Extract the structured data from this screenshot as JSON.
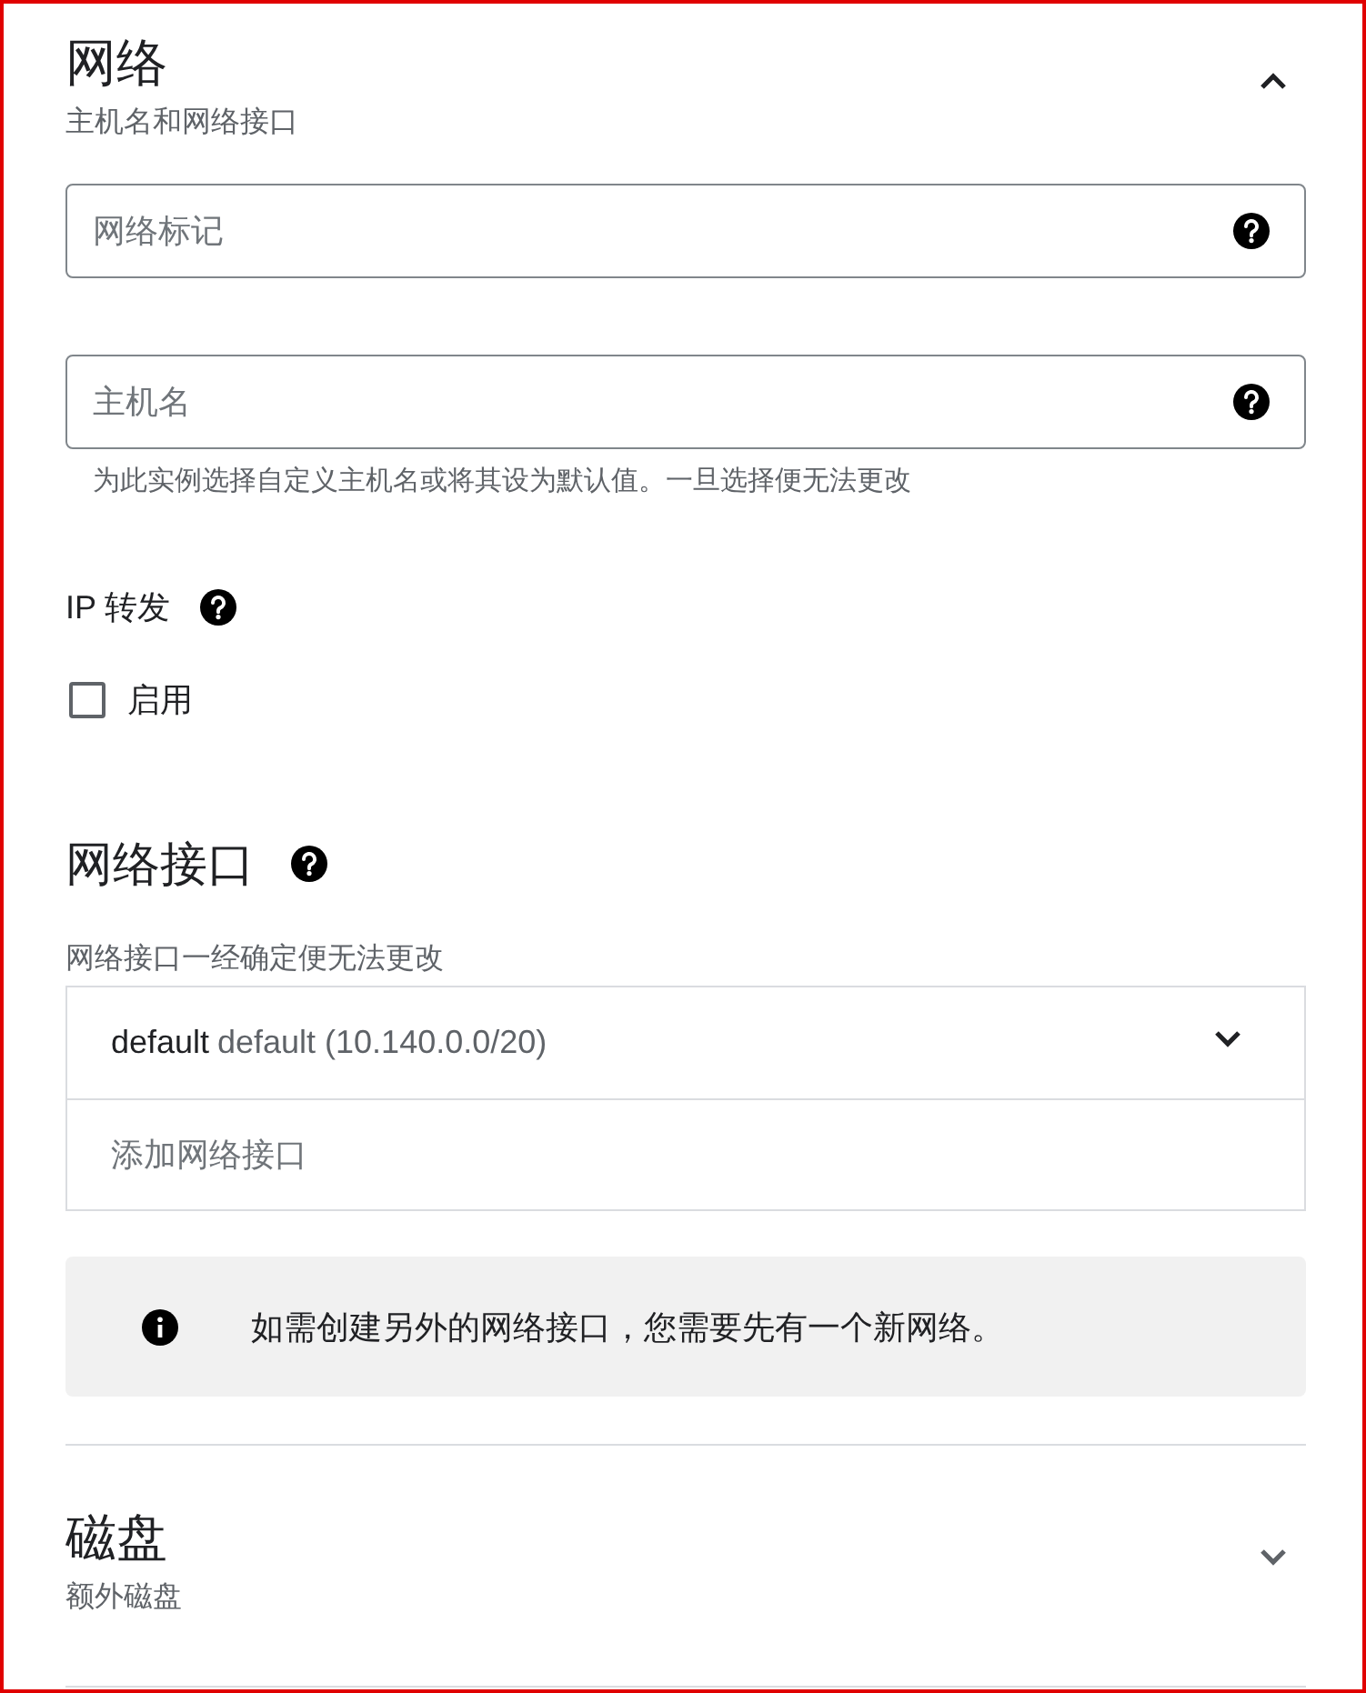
{
  "section": {
    "title": "网络",
    "subtitle": "主机名和网络接口",
    "expanded": true
  },
  "fields": [
    {
      "placeholder": "网络标记"
    },
    {
      "placeholder": "主机名",
      "hint": "为此实例选择自定义主机名或将其设为默认值。一旦选择便无法更改"
    }
  ],
  "ip_forwarding": {
    "label": "IP 转发",
    "checkbox": {
      "label": "启用",
      "checked": false
    }
  },
  "network_interfaces": {
    "title": "网络接口",
    "subtitle": "网络接口一经确定便无法更改",
    "items": [
      {
        "kind": "interface",
        "name": "default",
        "detail": "default (10.140.0.0/20)",
        "expanded": false
      },
      {
        "kind": "add",
        "label": "添加网络接口"
      }
    ]
  },
  "info": {
    "text": "如需创建另外的网络接口，您需要先有一个新网络。"
  },
  "disk_section": {
    "title": "磁盘",
    "subtitle": "额外磁盘",
    "expanded": false
  }
}
